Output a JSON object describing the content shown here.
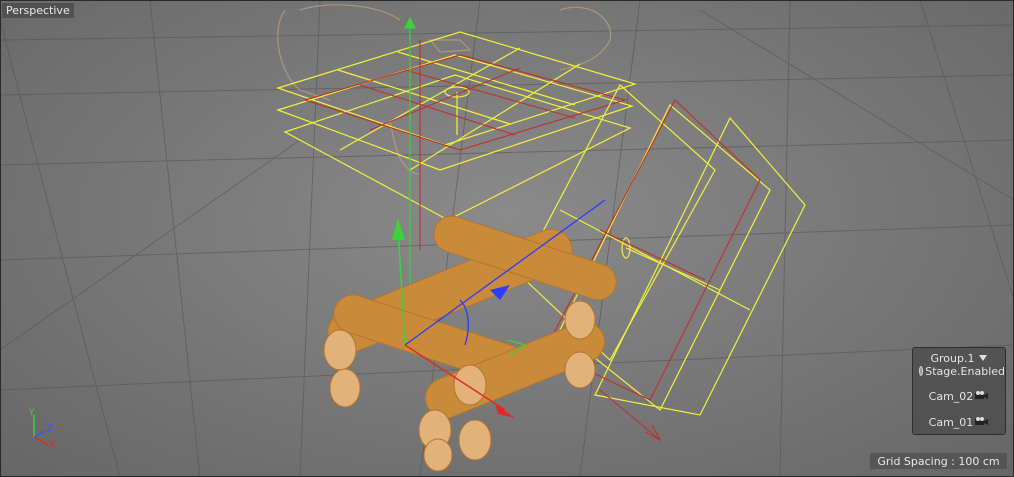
{
  "viewport": {
    "view_name": "Perspective",
    "grid_spacing_text": "Grid Spacing : 100 cm"
  },
  "stage_panel": {
    "group_label": "Group.1",
    "stage_label": "Stage.Enabled",
    "cameras": [
      "Cam_02",
      "Cam_01"
    ]
  },
  "axis_gizmo": {
    "x": "X",
    "y": "Y",
    "z": "Z"
  },
  "colors": {
    "object_orange": "#c98a3a",
    "wireframe_yellow": "#f2f03c",
    "wireframe_red": "#c0302c",
    "axis_green": "#3cd23c",
    "axis_red": "#e02a2a",
    "axis_blue": "#2a3cff"
  },
  "icons": [
    "dropdown-arrow-icon",
    "stage-toggle-icon",
    "camera-icon",
    "axis-gizmo-icon"
  ]
}
